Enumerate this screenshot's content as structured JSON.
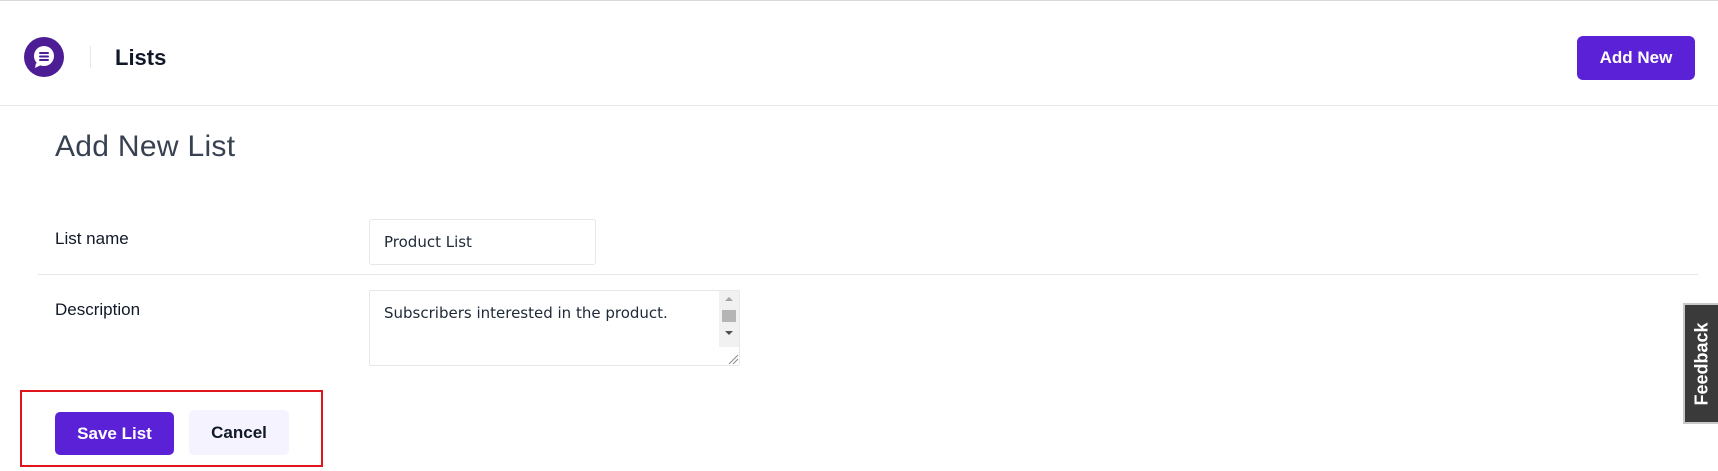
{
  "header": {
    "title": "Lists",
    "add_new_label": "Add New",
    "logo_icon": "chat-list-icon",
    "brand_color": "#5b21d6"
  },
  "form": {
    "heading": "Add New List",
    "list_name_label": "List name",
    "list_name_value": "Product List",
    "description_label": "Description",
    "description_value": "Subscribers interested in the product."
  },
  "actions": {
    "save_label": "Save List",
    "cancel_label": "Cancel",
    "highlight_color": "#e0151c"
  },
  "feedback": {
    "label": "Feedback"
  }
}
